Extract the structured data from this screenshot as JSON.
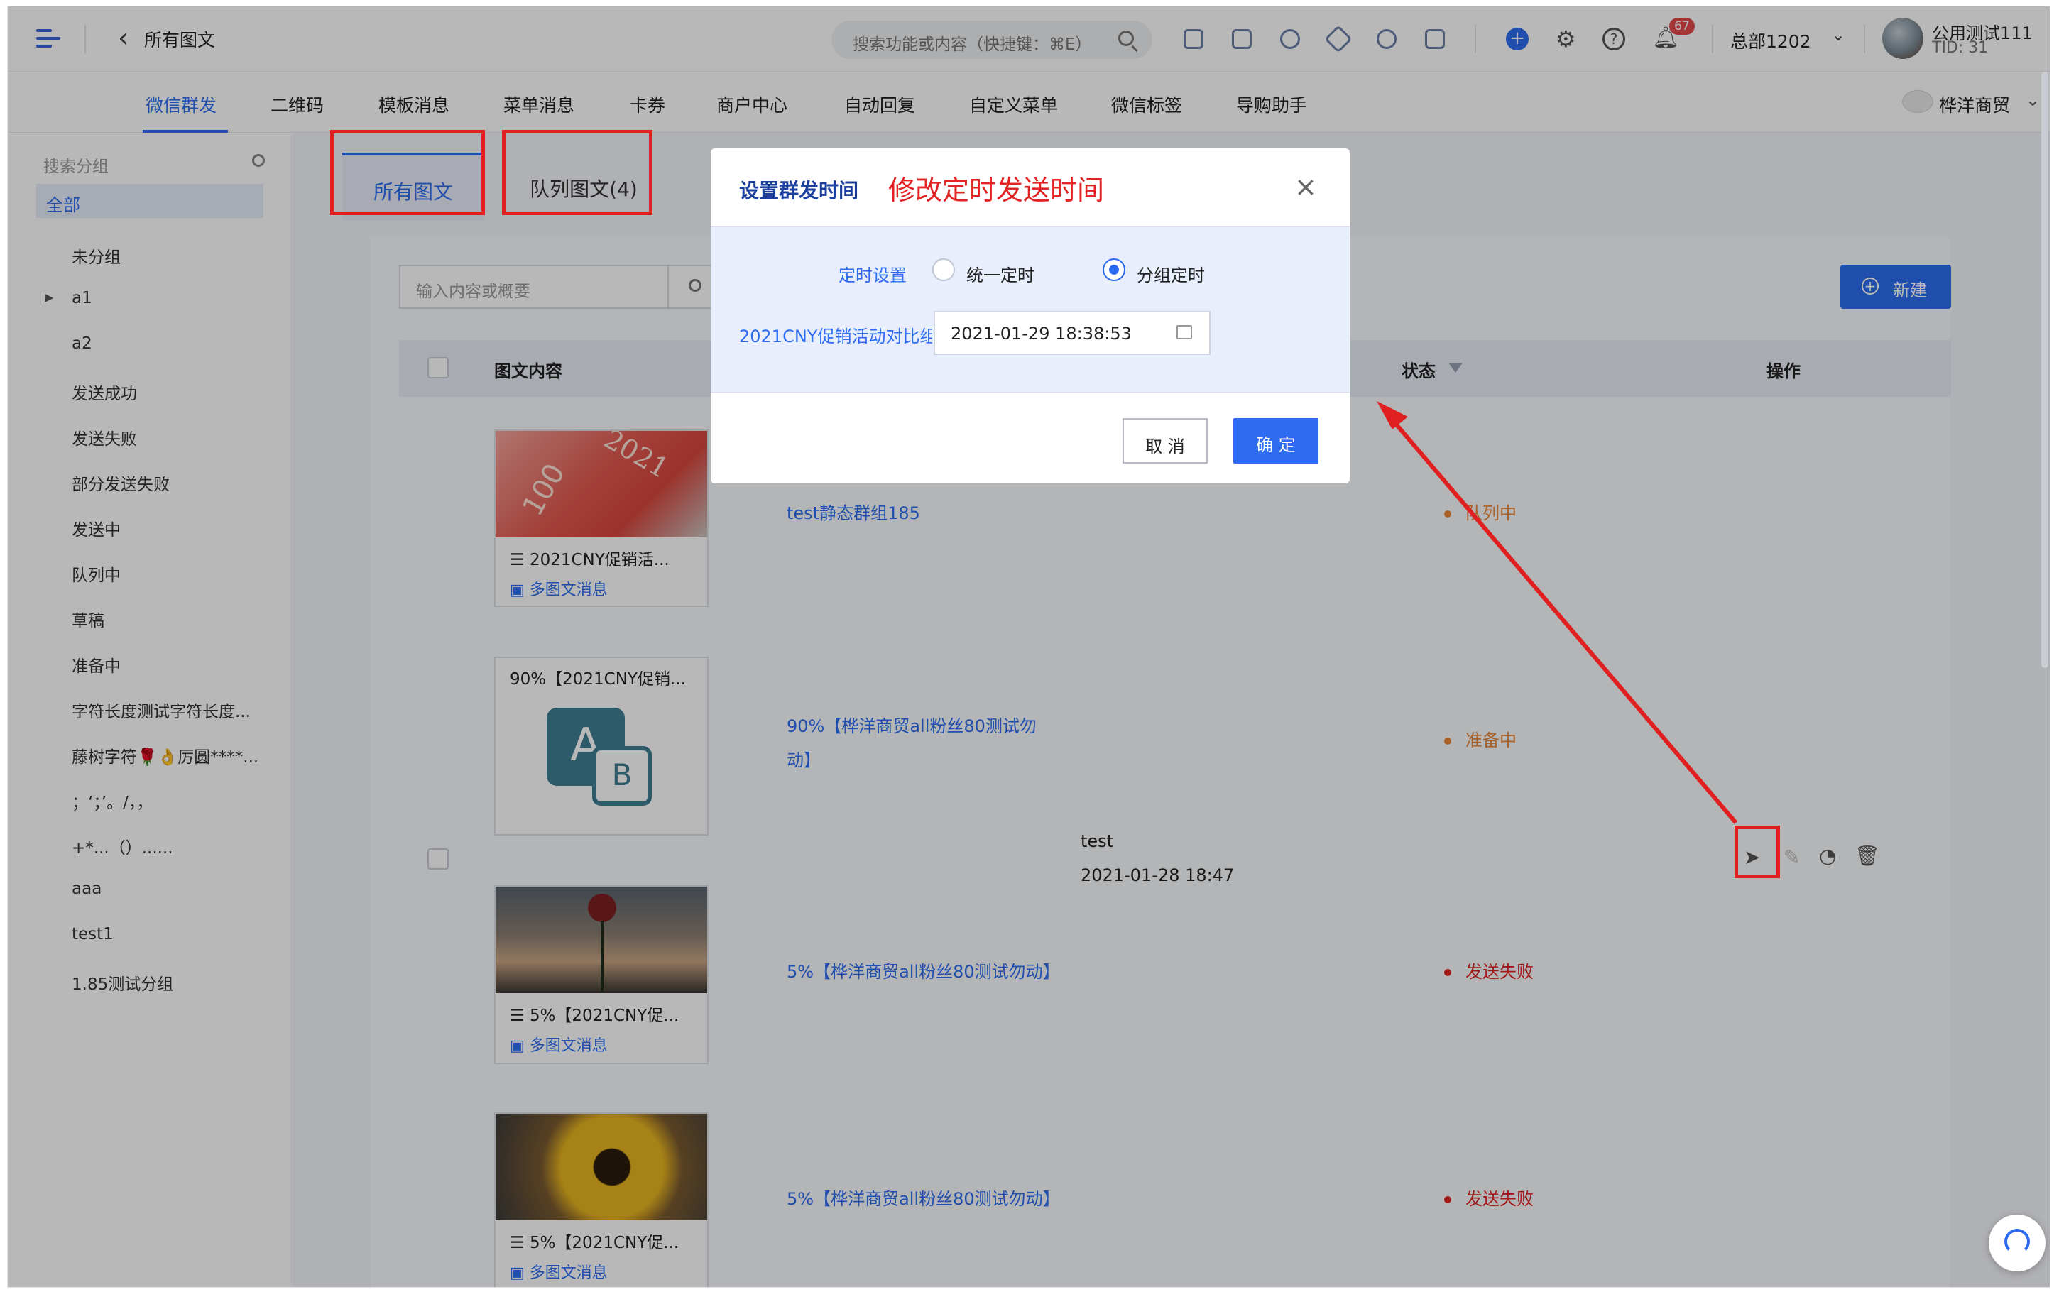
{
  "header": {
    "page_title": "所有图文",
    "search_placeholder": "搜索功能或内容（快捷键：⌘E）",
    "notification_count": "67",
    "org_name": "总部1202",
    "user_name": "公用测试111",
    "tid": "TID: 31"
  },
  "nav": {
    "items": [
      "微信群发",
      "二维码",
      "模板消息",
      "菜单消息",
      "卡券",
      "商户中心",
      "自动回复",
      "自定义菜单",
      "微信标签",
      "导购助手"
    ],
    "active_index": 0,
    "shop_name": "桦洋商贸"
  },
  "sidebar": {
    "search_placeholder": "搜索分组",
    "all_label": "全部",
    "items": [
      "未分组",
      "a1",
      "a2",
      "发送成功",
      "发送失败",
      "部分发送失败",
      "发送中",
      "队列中",
      "草稿",
      "准备中",
      "字符长度测试字符长度...",
      "藤树字符🌹👌厉圆****...",
      "；‘；’。/，，",
      "+*...（）......",
      "aaa",
      "test1",
      "1.85测试分组"
    ]
  },
  "tabs": {
    "all": "所有图文",
    "queue": "队列图文(4)"
  },
  "toolbar": {
    "search_placeholder": "输入内容或概要",
    "new_button": "新建"
  },
  "table": {
    "col_content": "图文内容",
    "col_status": "状态",
    "col_ops": "操作",
    "rows": [
      {
        "card_title": "2021CNY促销活...",
        "card_type": "多图文消息",
        "group": "test静态群组185",
        "status": "队列中"
      },
      {
        "card_title": "90%【2021CNY促销...",
        "card_type": "",
        "group_line1": "90%【桦洋商贸all粉丝80测试勿",
        "group_line2": "动】",
        "status": "准备中"
      },
      {
        "card_title": "5%【2021CNY促...",
        "card_type": "多图文消息",
        "group": "5%【桦洋商贸all粉丝80测试勿动】",
        "status": "发送失败"
      },
      {
        "card_title": "5%【2021CNY促...",
        "card_type": "多图文消息",
        "group": "5%【桦洋商贸all粉丝80测试勿动】",
        "status": "发送失败"
      }
    ],
    "creator": "test",
    "created_at": "2021-01-28 18:47"
  },
  "dialog": {
    "title": "设置群发时间",
    "annotation": "修改定时发送时间",
    "schedule_label": "定时设置",
    "option_unified": "统一定时",
    "option_grouped": "分组定时",
    "selected_option": "分组定时",
    "group_label": "2021CNY促销活动对比组",
    "datetime_value": "2021-01-29 18:38:53",
    "cancel": "取 消",
    "confirm": "确 定"
  },
  "colors": {
    "accent": "#2d6cf0",
    "annotation_red": "#e02020",
    "status_queue": "#e8873a",
    "status_failed": "#e02424"
  }
}
